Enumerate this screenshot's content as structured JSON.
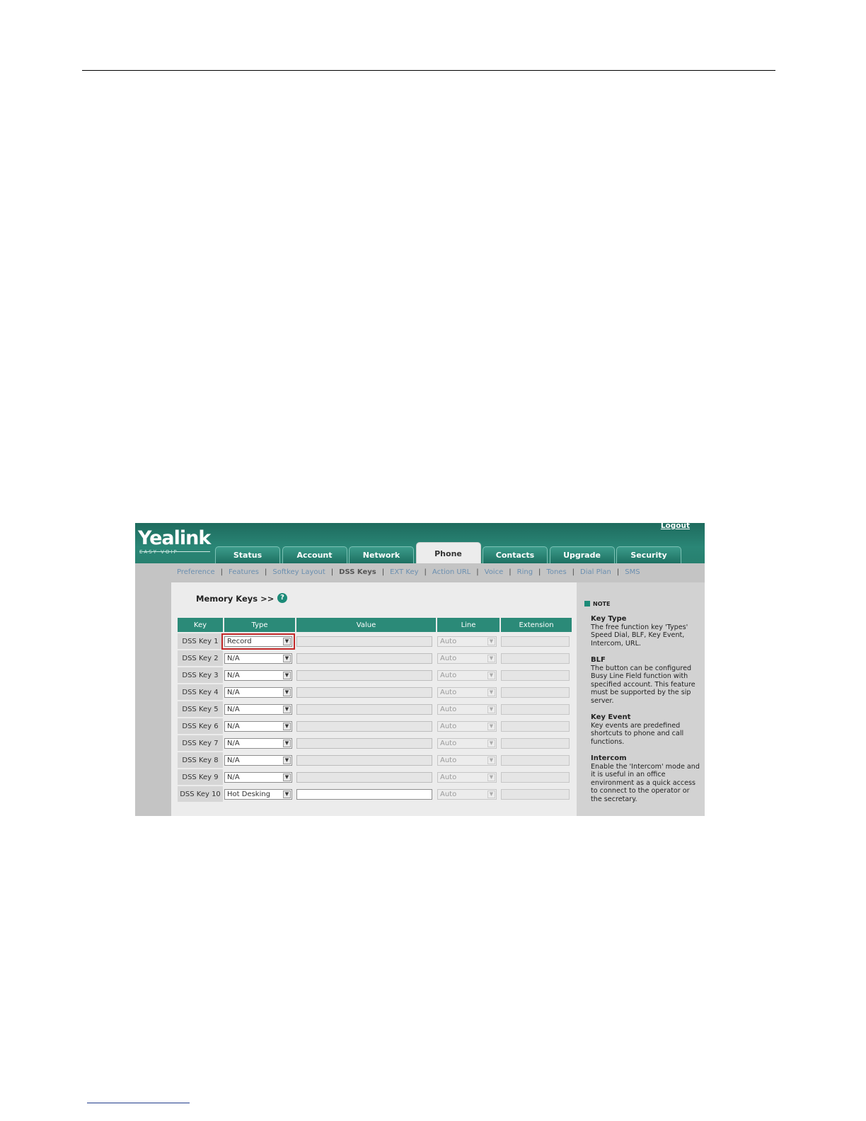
{
  "app": {
    "logo": "Yealink",
    "logo_tagline": "EASY VOIP",
    "logout": "Logout"
  },
  "tabs": [
    {
      "label": "Status"
    },
    {
      "label": "Account"
    },
    {
      "label": "Network"
    },
    {
      "label": "Phone",
      "active": true
    },
    {
      "label": "Contacts"
    },
    {
      "label": "Upgrade"
    },
    {
      "label": "Security"
    }
  ],
  "subnav": [
    "Preference",
    "Features",
    "Softkey Layout",
    "DSS Keys",
    "EXT Key",
    "Action URL",
    "Voice",
    "Ring",
    "Tones",
    "Dial Plan",
    "SMS"
  ],
  "subnav_active": "DSS Keys",
  "page": {
    "title": "Memory Keys >>",
    "help": "?"
  },
  "table": {
    "headers": {
      "key": "Key",
      "type": "Type",
      "value": "Value",
      "line": "Line",
      "extension": "Extension"
    },
    "rows": [
      {
        "key": "DSS Key 1",
        "type": "Record",
        "line": "Auto"
      },
      {
        "key": "DSS Key 2",
        "type": "N/A",
        "line": "Auto"
      },
      {
        "key": "DSS Key 3",
        "type": "N/A",
        "line": "Auto"
      },
      {
        "key": "DSS Key 4",
        "type": "N/A",
        "line": "Auto"
      },
      {
        "key": "DSS Key 5",
        "type": "N/A",
        "line": "Auto"
      },
      {
        "key": "DSS Key 6",
        "type": "N/A",
        "line": "Auto"
      },
      {
        "key": "DSS Key 7",
        "type": "N/A",
        "line": "Auto"
      },
      {
        "key": "DSS Key 8",
        "type": "N/A",
        "line": "Auto"
      },
      {
        "key": "DSS Key 9",
        "type": "N/A",
        "line": "Auto"
      },
      {
        "key": "DSS Key 10",
        "type": "Hot Desking",
        "line": "Auto"
      }
    ]
  },
  "note": {
    "heading": "NOTE",
    "sections": [
      {
        "title": "Key Type",
        "text": "The free function key 'Types' Speed Dial, BLF, Key Event, Intercom, URL."
      },
      {
        "title": "BLF",
        "text": "The button can be configured Busy Line Field function with specified account. This feature must be supported by the sip server."
      },
      {
        "title": "Key Event",
        "text": "Key events are predefined shortcuts to phone and call functions."
      },
      {
        "title": "Intercom",
        "text": "Enable the 'Intercom' mode and it is useful in an office environment as a quick access to connect to the operator or the secretary."
      }
    ]
  }
}
